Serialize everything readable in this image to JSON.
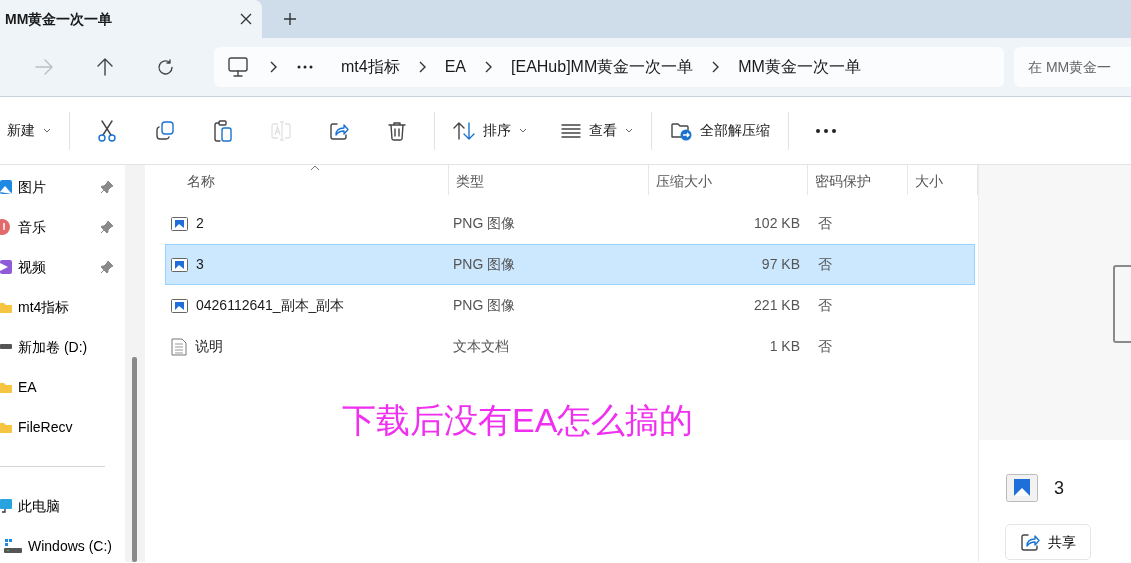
{
  "tab": {
    "title": "MM黄金一次一单"
  },
  "nav_buttons": [
    {
      "kind": "forward",
      "disabled": true
    },
    {
      "kind": "up",
      "disabled": false
    },
    {
      "kind": "refresh",
      "disabled": false
    }
  ],
  "breadcrumb": [
    "mt4指标",
    "EA",
    "[EAHub]MM黄金一次一单",
    "MM黄金一次一单"
  ],
  "search": {
    "placeholder": "在 MM黄金一"
  },
  "toolbar": [
    {
      "kind": "new",
      "label": "新建"
    },
    {
      "kind": "separator"
    },
    {
      "kind": "cut",
      "disabled": false
    },
    {
      "kind": "copy",
      "disabled": false
    },
    {
      "kind": "paste",
      "disabled": false
    },
    {
      "kind": "rename",
      "disabled": true
    },
    {
      "kind": "share",
      "disabled": false
    },
    {
      "kind": "delete",
      "disabled": false
    },
    {
      "kind": "separator"
    },
    {
      "kind": "sort",
      "label": "排序"
    },
    {
      "kind": "view",
      "label": "查看"
    },
    {
      "kind": "separator"
    },
    {
      "kind": "extract",
      "label": "全部解压缩"
    },
    {
      "kind": "separator"
    },
    {
      "kind": "more",
      "disabled": false
    }
  ],
  "sidebar": [
    {
      "label": "图片",
      "kind": "pictures",
      "pinned": true
    },
    {
      "label": "音乐",
      "kind": "music",
      "pinned": true
    },
    {
      "label": "视频",
      "kind": "videos",
      "pinned": true
    },
    {
      "label": "mt4指标",
      "kind": "folder",
      "pinned": false
    },
    {
      "label": "新加卷 (D:)",
      "kind": "drive",
      "pinned": false
    },
    {
      "label": "EA",
      "kind": "folder",
      "pinned": false
    },
    {
      "label": "FileRecv",
      "kind": "folder",
      "pinned": false
    }
  ],
  "this_pc": {
    "label": "此电脑",
    "children": [
      {
        "label": "Windows (C:)"
      }
    ]
  },
  "columns": [
    {
      "label": "名称",
      "sorted": true
    },
    {
      "label": "类型",
      "sorted": false
    },
    {
      "label": "压缩大小",
      "sorted": false
    },
    {
      "label": "密码保护",
      "sorted": false
    },
    {
      "label": "大小",
      "sorted": false
    }
  ],
  "files": [
    {
      "name": "2",
      "kind": "image",
      "type": "PNG 图像",
      "compressed_size": "102 KB",
      "password": "否",
      "selected": false
    },
    {
      "name": "3",
      "kind": "image",
      "type": "PNG 图像",
      "compressed_size": "97 KB",
      "password": "否",
      "selected": true
    },
    {
      "name": "0426112641_副本_副本",
      "kind": "image",
      "type": "PNG 图像",
      "compressed_size": "221 KB",
      "password": "否",
      "selected": false
    },
    {
      "name": "说明",
      "kind": "text",
      "type": "文本文档",
      "compressed_size": "1 KB",
      "password": "否",
      "selected": false
    }
  ],
  "annotation": "下载后没有EA怎么搞的",
  "preview": {
    "name": "3",
    "share_label": "共享"
  }
}
